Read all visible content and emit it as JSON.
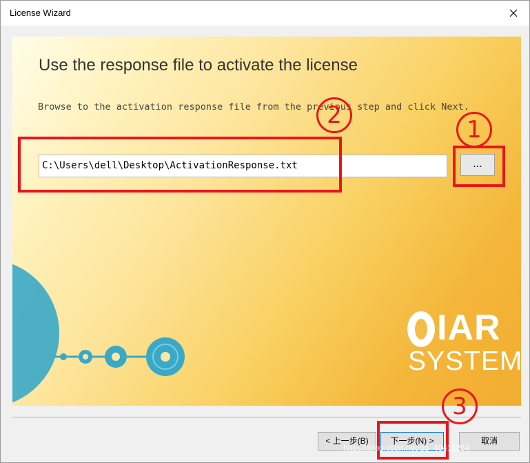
{
  "window": {
    "title": "License Wizard",
    "close_symbol": "✕"
  },
  "page": {
    "heading": "Use the response file to activate the license",
    "instructions": "Browse to the activation response file from the previous step and click Next.",
    "file_path": "C:\\Users\\dell\\Desktop\\ActivationResponse.txt",
    "browse_label": "..."
  },
  "logo": {
    "word1": "IAR",
    "word2": "SYSTEMS"
  },
  "buttons": {
    "back": "< 上一步(B)",
    "next": "下一步(N) >",
    "cancel": "取消"
  },
  "annotations": {
    "step1": "1",
    "step2": "2",
    "step3": "3",
    "color": "#e8161b"
  },
  "watermark": "https://blog.csdn.net/qq_40411264",
  "colors": {
    "panel_gradient_start": "#fffde8",
    "panel_gradient_end": "#f2ad30",
    "logo_blue": "#3aa9c8"
  }
}
